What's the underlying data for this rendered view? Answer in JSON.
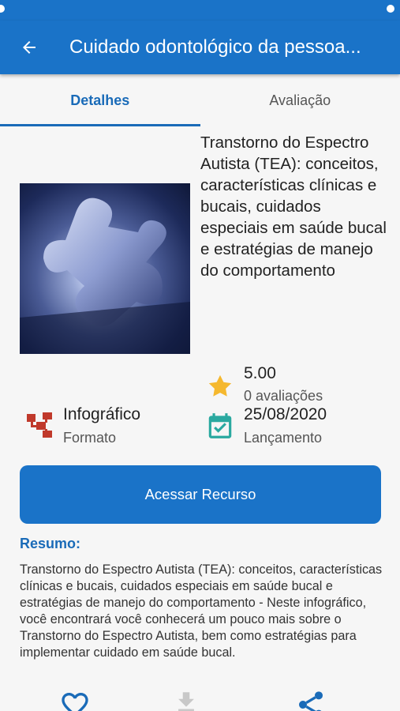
{
  "app_bar": {
    "title": "Cuidado odontológico da pessoa..."
  },
  "icons": {
    "back": "arrow-back-icon",
    "rating": "star-icon",
    "format": "sitemap-icon",
    "date": "calendar-check-icon",
    "favorite": "heart-icon",
    "download": "download-icon",
    "share": "share-icon"
  },
  "tabs": [
    {
      "label": "Detalhes",
      "active": true
    },
    {
      "label": "Avaliação",
      "active": false
    }
  ],
  "resource": {
    "title": "Transtorno do Espectro Autista (TEA): conceitos, características clínicas e bucais, cuidados especiais em saúde bucal e estratégias de manejo do comportamento",
    "rating_value": "5.00",
    "rating_count": "0 avaliações",
    "format_value": "Infográfico",
    "format_label": "Formato",
    "date_value": "25/08/2020",
    "date_label": "Lançamento"
  },
  "actions": {
    "access_label": "Acessar Recurso"
  },
  "summary": {
    "heading": "Resumo:",
    "text": "Transtorno do Espectro Autista (TEA): conceitos, características clínicas e bucais, cuidados especiais em saúde bucal e estratégias de manejo do comportamento - Neste infográfico, você encontrará você conhecerá um pouco mais sobre o Transtorno do Espectro Autista, bem como estratégias para implementar cuidado em saúde bucal."
  },
  "colors": {
    "primary": "#1a73c8",
    "star": "#f5b82e",
    "format_icon": "#c0392b",
    "date_icon": "#2aa9a0"
  }
}
